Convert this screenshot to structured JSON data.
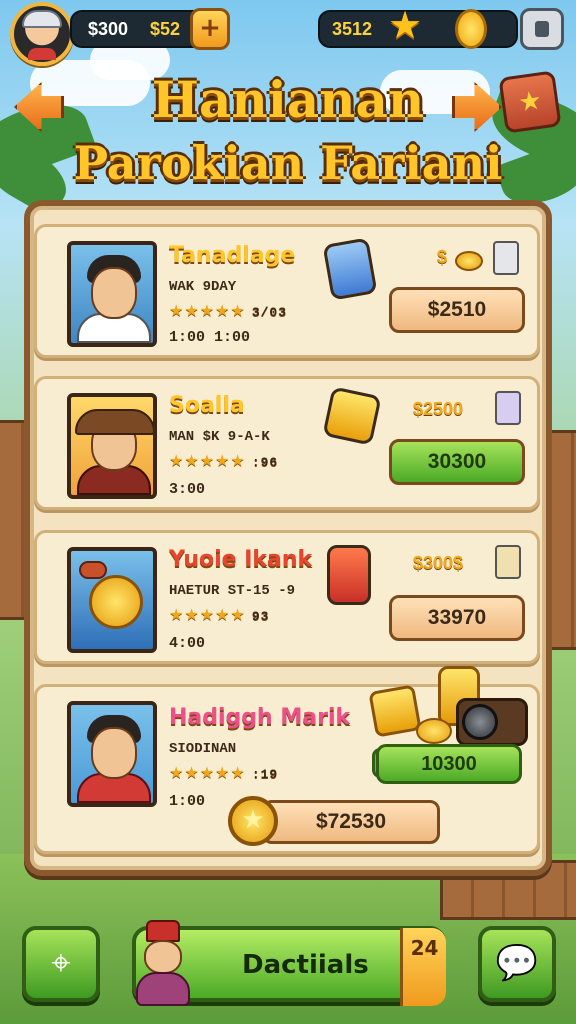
{
  "hud": {
    "money_value": "$300",
    "cash_value": "$52",
    "plus_symbol": "+",
    "gems_value": "3512"
  },
  "title": {
    "line1": "Hanianan",
    "line2": "Parokian Fariani"
  },
  "listings": [
    {
      "name": "Tanadlage",
      "subtitle": "WAK 9DAY",
      "stars": "★★★★★",
      "rating": "3/03",
      "times": "1:00   1:00",
      "price": "$",
      "button": "$2510",
      "name_color": "#ffc529"
    },
    {
      "name": "Soalla",
      "subtitle": "MAN $K 9-A-K",
      "stars": "★★★★★",
      "rating": ":96",
      "times": "3:00",
      "price": "$2500",
      "button": "30300",
      "name_color": "#ffc529"
    },
    {
      "name": "Yuoie Ikank",
      "subtitle": "HAETUR ST-15 -9",
      "stars": "★★★★★",
      "rating": "93",
      "times": "4:00",
      "price": "$300$",
      "button": "33970",
      "name_color": "#e8462c"
    },
    {
      "name": "Hadiggh Marik",
      "subtitle": "SIODINAN",
      "stars": "★★★★★",
      "rating": ":19",
      "times": "1:00",
      "price_small": "10300",
      "button": "$72530",
      "name_color": "#ee4f8a"
    }
  ],
  "footer": {
    "details_label": "Dactiials",
    "details_badge": "24"
  }
}
